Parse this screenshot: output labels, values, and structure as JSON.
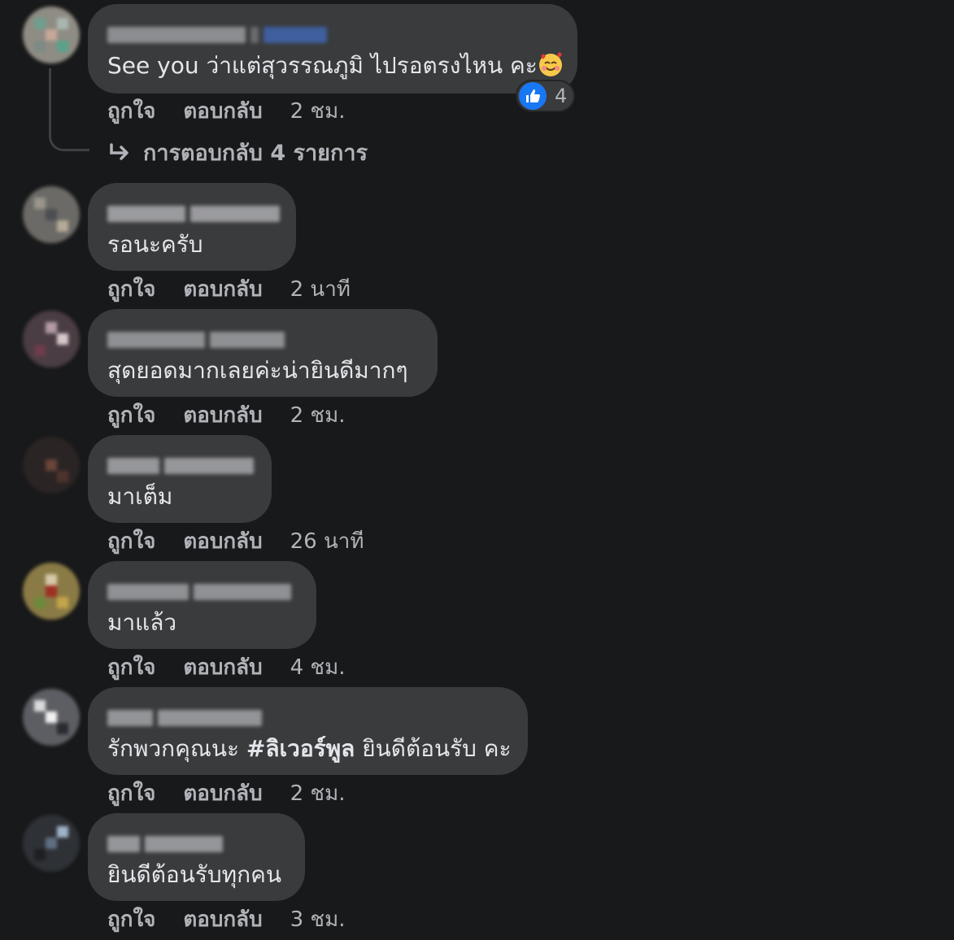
{
  "actions": {
    "like": "ถูกใจ",
    "reply": "ตอบกลับ"
  },
  "comments": [
    {
      "text_prefix": "See you ว่าแต่สุวรรณภูมิ ไปรอตรงไหน คะ",
      "emoji": "smiling-face-with-hearts",
      "time": "2 ชม.",
      "reaction_count": "4",
      "replies_label": "การตอบกลับ 4 รายการ"
    },
    {
      "text": "รอนะครับ",
      "time": "2 นาที"
    },
    {
      "text": "สุดยอดมากเลยค่ะน่ายินดีมากๆ",
      "time": "2 ชม."
    },
    {
      "text": "มาเต็ม",
      "time": "26 นาที"
    },
    {
      "text": "มาแล้ว",
      "time": "4 ชม."
    },
    {
      "text_before": "รักพวกคุณนะ",
      "hashtag": "#ลิเวอร์พูล",
      "text_after": "ยินดีต้อนรับ คะ",
      "time": "2 ชม."
    },
    {
      "text": "ยินดีต้อนรับทุกคน",
      "time": "3 ชม."
    }
  ],
  "colors": {
    "background": "#18191a",
    "bubble": "#3a3b3c",
    "primary_text": "#e4e6eb",
    "secondary_text": "#b0b3b8",
    "like_blue": "#1877f2"
  },
  "icons": {
    "like": "thumbs-up-icon",
    "reply_arrow": "reply-arrow-icon"
  }
}
